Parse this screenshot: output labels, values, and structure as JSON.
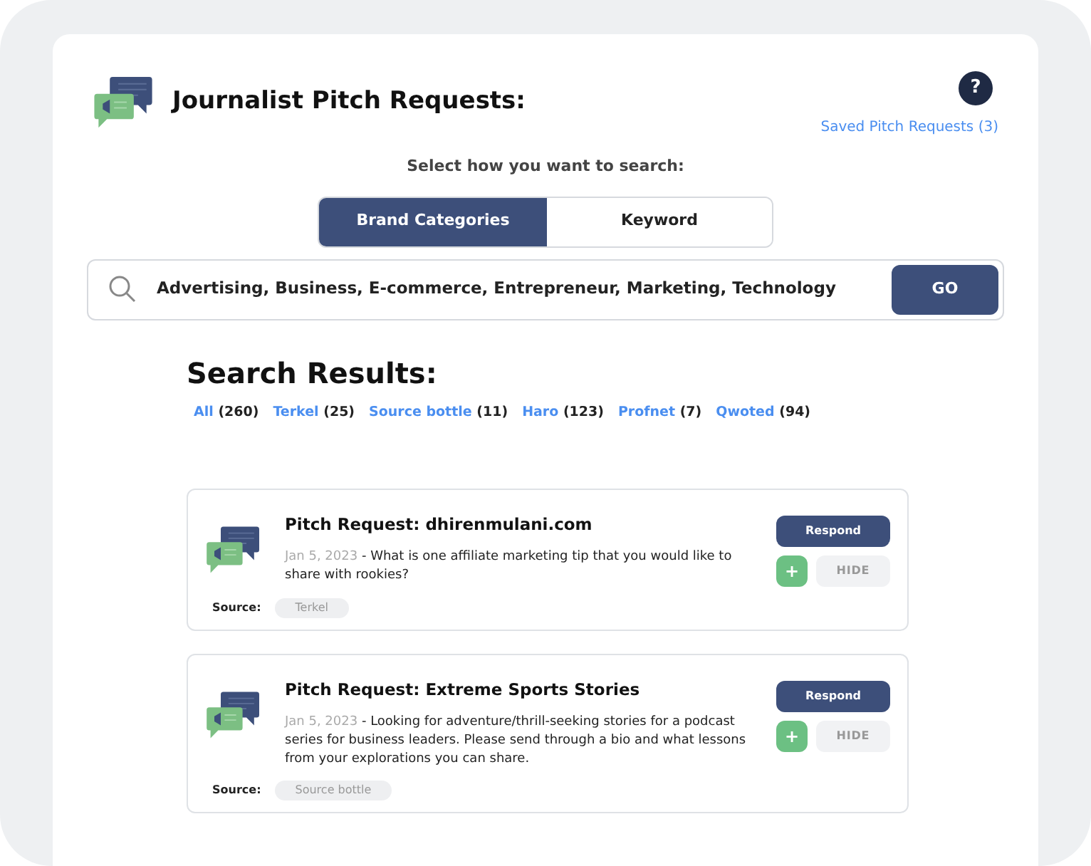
{
  "header": {
    "title": "Journalist Pitch Requests:",
    "help": "?",
    "saved_link": "Saved Pitch Requests (3)"
  },
  "search_mode": {
    "label": "Select how you want to search:",
    "tabs": [
      {
        "label": "Brand Categories",
        "selected": true
      },
      {
        "label": "Keyword",
        "selected": false
      }
    ]
  },
  "search": {
    "value": "Advertising, Business, E-commerce, Entrepreneur, Marketing, Technology",
    "button": "GO"
  },
  "results": {
    "title": "Search Results:",
    "filters": [
      {
        "label": "All",
        "count": "(260)"
      },
      {
        "label": "Terkel",
        "count": "(25)"
      },
      {
        "label": "Source bottle",
        "count": "(11)"
      },
      {
        "label": "Haro",
        "count": "(123)"
      },
      {
        "label": "Profnet",
        "count": "(7)"
      },
      {
        "label": "Qwoted",
        "count": "(94)"
      }
    ],
    "cards": [
      {
        "title": "Pitch Request: dhirenmulani.com",
        "date": "Jan 5, 2023",
        "description": " - What is one affiliate marketing tip that you would like to share with rookies?",
        "respond": "Respond",
        "add": "+",
        "hide": "HIDE",
        "source_label": "Source:",
        "source": "Terkel"
      },
      {
        "title": "Pitch Request: Extreme Sports Stories",
        "date": "Jan 5, 2023",
        "description": " - Looking for adventure/thrill-seeking stories for a podcast series for business leaders. Please send through a bio and what lessons from your explorations you can share.",
        "respond": "Respond",
        "add": "+",
        "hide": "HIDE",
        "source_label": "Source:",
        "source": "Source bottle"
      }
    ]
  }
}
